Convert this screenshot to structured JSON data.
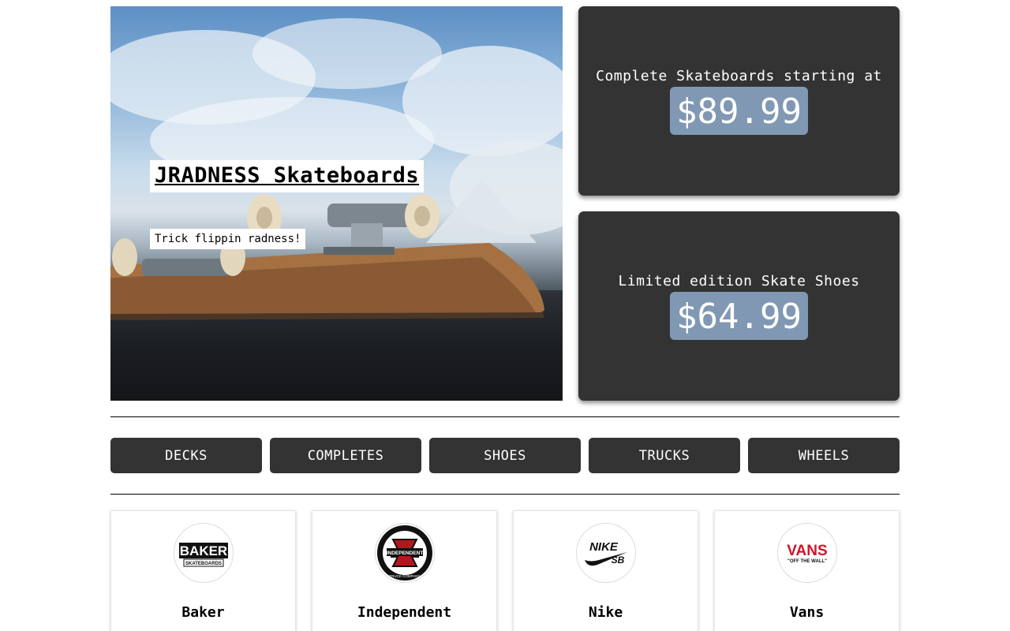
{
  "hero": {
    "title": "JRADNESS Skateboards",
    "subtitle": "Trick flippin radness!"
  },
  "promos": [
    {
      "label": "Complete Skateboards starting at",
      "price": "$89.99"
    },
    {
      "label": "Limited edition Skate Shoes",
      "price": "$64.99"
    }
  ],
  "nav": {
    "items": [
      "DECKS",
      "COMPLETES",
      "SHOES",
      "TRUCKS",
      "WHEELS"
    ]
  },
  "brands": [
    {
      "name": "Baker",
      "logo_text": "BAKER",
      "logo_sub": "SKATEBOARDS",
      "icon": "baker-logo-icon"
    },
    {
      "name": "Independent",
      "logo_text": "INDEPENDENT",
      "logo_sub": "TRUCK COMPANY",
      "icon": "independent-logo-icon"
    },
    {
      "name": "Nike",
      "logo_text": "NIKE",
      "logo_sub": "SB",
      "icon": "nike-sb-logo-icon"
    },
    {
      "name": "Vans",
      "logo_text": "VANS",
      "logo_sub": "\"OFF THE WALL\"",
      "icon": "vans-logo-icon"
    }
  ],
  "colors": {
    "panel": "#333333",
    "price_badge": "#8098b3",
    "text_light": "#ffffff"
  }
}
